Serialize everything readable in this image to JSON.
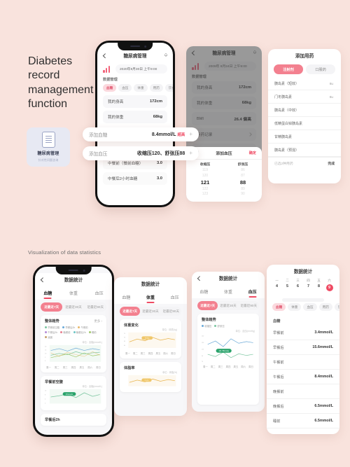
{
  "page": {
    "headline": "Diabetes record management function",
    "section_label": "Visualization of data statistics",
    "bg_color": "#f9e3dd",
    "accent_color": "#ef4a63"
  },
  "feature_card": {
    "icon": "record-document-icon",
    "title": "糖尿病管理",
    "subtitle": "针对性问题咨询"
  },
  "phone1": {
    "nav": {
      "back_icon": "chevron-left-icon",
      "title": "糖尿病管理",
      "bell_icon": "bell-icon"
    },
    "chart_icon": "bar-chart-icon",
    "date_pill": "2020年9月30日  上午9:00",
    "section": "数据管理",
    "chips": [
      "血糖",
      "血压",
      "体重",
      "用药",
      "饮食"
    ],
    "rows": [
      {
        "label": "我的身高",
        "value": "172cm"
      },
      {
        "label": "我的体重",
        "value": "68kg"
      }
    ],
    "bottom_rows": [
      {
        "label": "中餐前（餐前血糖）",
        "value": "3.0"
      },
      {
        "label": "中餐后2小时血糖",
        "value": "3.0"
      }
    ]
  },
  "overlays": [
    {
      "label": "添加血糖",
      "value": "8.4mmol/L",
      "flag": "超高",
      "plus": "+"
    },
    {
      "label": "添加血压",
      "value": "收缩压120、舒张压88",
      "flag": "",
      "plus": "+"
    }
  ],
  "phone2": {
    "nav": {
      "back_icon": "chevron-left-icon",
      "title": "糖尿病管理",
      "bell_icon": "bell-icon"
    },
    "date_pill": "2009年 9月24日  上午9:00",
    "section": "数据管理",
    "rows": [
      {
        "label": "我的身高",
        "value": "172cm"
      },
      {
        "label": "我的体重",
        "value": "68kg"
      },
      {
        "label": "BMI",
        "value": "26.4 偏高"
      },
      {
        "label": "用药记录",
        "value": ""
      },
      {
        "label": "饮食记录",
        "value": ""
      }
    ],
    "picker": {
      "cancel": "取消",
      "title": "添加血压",
      "confirm": "确定",
      "columns": [
        {
          "header": "收缩压",
          "values": [
            "119",
            "120",
            "121",
            "122",
            "123"
          ],
          "selected": "121"
        },
        {
          "header": "舒张压",
          "values": [
            "86",
            "87",
            "88",
            "89",
            "90"
          ],
          "selected": "88"
        }
      ]
    }
  },
  "phone3": {
    "title": "添加用药",
    "tabs": [
      {
        "label": "注射剂",
        "active": true
      },
      {
        "label": "口服药",
        "active": false
      }
    ],
    "items": [
      {
        "name": "胰岛素（短效）",
        "unit": "8u"
      },
      {
        "name": "门冬胰岛素",
        "unit": "8u"
      },
      {
        "name": "胰岛素（中效）",
        "unit": ""
      },
      {
        "name": "低精蛋白锌胰岛素",
        "unit": ""
      },
      {
        "name": "甘精胰岛素",
        "unit": ""
      },
      {
        "name": "胰岛素（预混）",
        "unit": ""
      }
    ],
    "footer": {
      "note": "已选2种用药",
      "done": "完成"
    }
  },
  "stats1": {
    "nav": {
      "back_icon": "chevron-left-icon",
      "title": "数据统计"
    },
    "tabs": [
      {
        "label": "血糖",
        "active": true
      },
      {
        "label": "体重",
        "active": false
      },
      {
        "label": "血压",
        "active": false
      }
    ],
    "ranges": [
      {
        "label": "近最近7天",
        "active": true
      },
      {
        "label": "近最近30天",
        "active": false
      },
      {
        "label": "近最近90天",
        "active": false
      }
    ],
    "card1": {
      "title": "整体趋势",
      "more": "更多 ›",
      "note": "单位：血糖(mmol/L)",
      "legend": [
        "早餐前空腹",
        "早餐后2h",
        "午餐前",
        "午餐后2h",
        "晚餐前",
        "晚餐后2h",
        "睡前",
        "凌晨"
      ]
    },
    "card2": {
      "title": "早餐前空腹",
      "note": "单位：血糖(mmol/L)",
      "tag": "6.5mmol/L"
    },
    "card3": {
      "title": "早餐后2h"
    }
  },
  "stats2": {
    "title": "数据统计",
    "tabs": [
      {
        "label": "血糖",
        "active": false
      },
      {
        "label": "体重",
        "active": true
      },
      {
        "label": "血压",
        "active": false
      }
    ],
    "ranges": [
      {
        "label": "近最近7天",
        "active": true
      },
      {
        "label": "近最近30天",
        "active": false
      },
      {
        "label": "近最近90天",
        "active": false
      }
    ],
    "card1": {
      "title": "体重变化",
      "note": "单位：体重(kg)",
      "tag": "68.0kg"
    },
    "card2": {
      "title": "体脂率",
      "note": "单位：体脂(%)",
      "tag": "21.4%"
    }
  },
  "stats3": {
    "title": "数据统计",
    "tabs": [
      {
        "label": "血糖",
        "active": false
      },
      {
        "label": "体重",
        "active": false
      },
      {
        "label": "血压",
        "active": true
      }
    ],
    "ranges": [
      {
        "label": "近最近7天",
        "active": true
      },
      {
        "label": "近最近30天",
        "active": false
      },
      {
        "label": "近最近90天",
        "active": false
      }
    ],
    "card1": {
      "title": "整体趋势",
      "note": "单位：血压(mmHg)",
      "legend": [
        "收缩压",
        "舒张压"
      ],
      "tag": "120 / 88mmHg"
    }
  },
  "stats4": {
    "title": "数据统计",
    "weekdays": [
      "一",
      "二",
      "三",
      "四",
      "五",
      "六"
    ],
    "dates": [
      "4",
      "5",
      "6",
      "7",
      "8",
      "9"
    ],
    "selected_date": "9",
    "chips": [
      "血糖",
      "体重",
      "血压",
      "用药",
      "饮食"
    ],
    "list_title": "血糖",
    "rows": [
      {
        "label": "早餐前",
        "value": "3.4mmol/L"
      },
      {
        "label": "早餐后",
        "value": "15.6mmol/L"
      },
      {
        "label": "午餐前",
        "value": ""
      },
      {
        "label": "午餐后",
        "value": "8.4mmol/L"
      },
      {
        "label": "晚餐前",
        "value": ""
      },
      {
        "label": "晚餐后",
        "value": "6.5mmol/L"
      },
      {
        "label": "睡前",
        "value": "6.5mmol/L"
      }
    ]
  },
  "chart_data": [
    {
      "type": "line",
      "title": "整体趋势",
      "ylabel": "血糖 (mmol/L)",
      "xlabel": "",
      "ylim": [
        0,
        20
      ],
      "categories": [
        "周一",
        "周二",
        "周三",
        "周四",
        "周五",
        "周六",
        "周日"
      ],
      "series": [
        {
          "name": "早餐前空腹",
          "values": [
            6.5,
            7.2,
            6.8,
            8.1,
            7.4,
            6.9,
            7.6
          ]
        },
        {
          "name": "早餐后2h",
          "values": [
            9.8,
            11.2,
            10.1,
            12.4,
            10.6,
            11.8,
            10.3
          ]
        },
        {
          "name": "午餐前",
          "values": [
            5.8,
            6.4,
            7.1,
            6.2,
            7.8,
            6.6,
            7.0
          ]
        }
      ],
      "grid": false,
      "legend": "top"
    },
    {
      "type": "line",
      "title": "早餐前空腹",
      "ylabel": "血糖 (mmol/L)",
      "ylim": [
        0,
        12
      ],
      "categories": [
        "周一",
        "周二",
        "周三",
        "周四",
        "周五",
        "周六",
        "周日"
      ],
      "series": [
        {
          "name": "早餐前空腹",
          "values": [
            6.5,
            6.8,
            7.4,
            6.2,
            7.9,
            6.6,
            7.1
          ]
        }
      ],
      "annotation": "6.5mmol/L"
    },
    {
      "type": "line",
      "title": "体重变化",
      "ylabel": "体重 (kg)",
      "ylim": [
        60,
        75
      ],
      "categories": [
        "周一",
        "周二",
        "周三",
        "周四",
        "周五",
        "周六",
        "周日"
      ],
      "series": [
        {
          "name": "体重",
          "values": [
            68.0,
            68.4,
            67.8,
            69.1,
            68.5,
            68.2,
            68.0
          ]
        }
      ],
      "annotation": "68.0kg"
    },
    {
      "type": "line",
      "title": "体脂率",
      "ylabel": "体脂 (%)",
      "ylim": [
        15,
        30
      ],
      "categories": [
        "周一",
        "周二",
        "周三",
        "周四",
        "周五",
        "周六",
        "周日"
      ],
      "series": [
        {
          "name": "体脂率",
          "values": [
            21.4,
            21.8,
            21.2,
            22.3,
            21.6,
            21.5,
            21.4
          ]
        }
      ],
      "annotation": "21.4%"
    },
    {
      "type": "line",
      "title": "血压整体趋势",
      "ylabel": "血压 (mmHg)",
      "ylim": [
        60,
        150
      ],
      "categories": [
        "周一",
        "周二",
        "周三",
        "周四",
        "周五",
        "周六",
        "周日"
      ],
      "series": [
        {
          "name": "收缩压",
          "values": [
            120,
            124,
            118,
            128,
            122,
            121,
            120
          ]
        },
        {
          "name": "舒张压",
          "values": [
            88,
            86,
            90,
            84,
            87,
            88,
            88
          ]
        }
      ],
      "annotation": "120 / 88mmHg"
    }
  ]
}
